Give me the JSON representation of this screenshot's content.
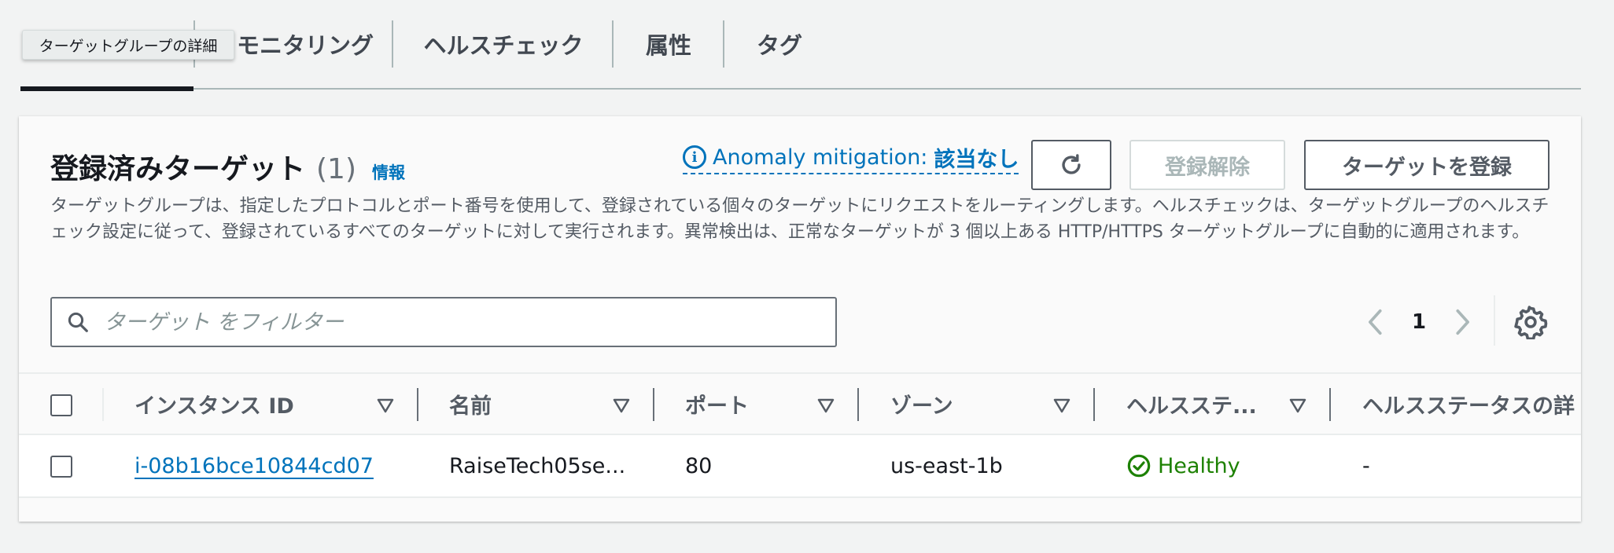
{
  "tooltip": "ターゲットグループの詳細",
  "tabs": [
    {
      "label": "モニタリング"
    },
    {
      "label": "ヘルスチェック"
    },
    {
      "label": "属性"
    },
    {
      "label": "タグ"
    }
  ],
  "panel": {
    "title": "登録済みターゲット",
    "count": "(1)",
    "info": "情報",
    "anomaly_label": "Anomaly mitigation: ",
    "anomaly_value": "該当なし",
    "deregister_label": "登録解除",
    "register_label": "ターゲットを登録",
    "description": "ターゲットグループは、指定したプロトコルとポート番号を使用して、登録されている個々のターゲットにリクエストをルーティングします。ヘルスチェックは、ターゲットグループのヘルスチェック設定に従って、登録されているすべてのターゲットに対して実行されます。異常検出は、正常なターゲットが 3 個以上ある HTTP/HTTPS ターゲットグループに自動的に適用されます。"
  },
  "search": {
    "placeholder": "ターゲット をフィルター",
    "value": ""
  },
  "pagination": {
    "current_page": "1"
  },
  "table": {
    "columns": [
      "インスタンス ID",
      "名前",
      "ポート",
      "ゾーン",
      "ヘルスステ...",
      "ヘルスステータスの詳"
    ],
    "rows": [
      {
        "instance_id": "i-08b16bce10844cd07",
        "name": "RaiseTech05se...",
        "port": "80",
        "zone": "us-east-1b",
        "health": "Healthy",
        "health_detail": "-"
      }
    ]
  },
  "colors": {
    "link": "#0073bb",
    "healthy": "#1d8102",
    "text": "#16191f"
  }
}
